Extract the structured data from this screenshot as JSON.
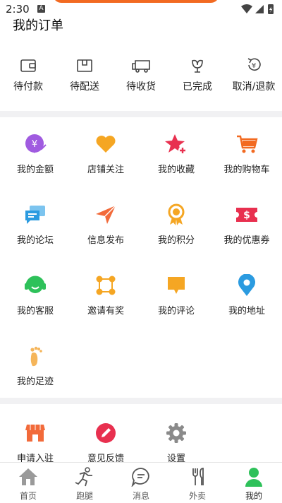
{
  "status_bar": {
    "time": "2:30",
    "sim_label": "A"
  },
  "orders": {
    "title": "我的订单",
    "items": [
      {
        "label": "待付款",
        "icon": "wallet-icon"
      },
      {
        "label": "待配送",
        "icon": "package-icon"
      },
      {
        "label": "待收货",
        "icon": "truck-icon"
      },
      {
        "label": "已完成",
        "icon": "flower-icon"
      },
      {
        "label": "取消/退款",
        "icon": "refund-icon"
      }
    ]
  },
  "services": {
    "items": [
      {
        "label": "我的金额",
        "icon": "money-icon",
        "color": "#a05be0"
      },
      {
        "label": "店铺关注",
        "icon": "heart-icon",
        "color": "#f5a623"
      },
      {
        "label": "我的收藏",
        "icon": "star-plus-icon",
        "color": "#e8304f"
      },
      {
        "label": "我的购物车",
        "icon": "cart-icon",
        "color": "#f26a21"
      },
      {
        "label": "我的论坛",
        "icon": "forum-icon",
        "color": "#2b9be0"
      },
      {
        "label": "信息发布",
        "icon": "paper-plane-icon",
        "color": "#f26a3a"
      },
      {
        "label": "我的积分",
        "icon": "medal-icon",
        "color": "#f5a623"
      },
      {
        "label": "我的优惠券",
        "icon": "coupon-icon",
        "color": "#e8304f"
      },
      {
        "label": "我的客服",
        "icon": "headset-icon",
        "color": "#2ec15a"
      },
      {
        "label": "邀请有奖",
        "icon": "invite-icon",
        "color": "#f5a623"
      },
      {
        "label": "我的评论",
        "icon": "comment-icon",
        "color": "#f5a623"
      },
      {
        "label": "我的地址",
        "icon": "location-icon",
        "color": "#2b9be0"
      },
      {
        "label": "我的足迹",
        "icon": "footprint-icon",
        "color": "#f5b55a"
      }
    ]
  },
  "tools": {
    "items": [
      {
        "label": "申请入驻",
        "icon": "shop-icon",
        "color": "#f26a3a"
      },
      {
        "label": "意见反馈",
        "icon": "feedback-icon",
        "color": "#e8304f"
      },
      {
        "label": "设置",
        "icon": "settings-icon",
        "color": "#8a8a8a"
      }
    ]
  },
  "tabbar": {
    "active_index": 4,
    "tabs": [
      {
        "label": "首页",
        "icon": "home-icon"
      },
      {
        "label": "跑腿",
        "icon": "runner-icon"
      },
      {
        "label": "消息",
        "icon": "message-icon"
      },
      {
        "label": "外卖",
        "icon": "utensils-icon"
      },
      {
        "label": "我的",
        "icon": "user-icon"
      }
    ]
  },
  "colors": {
    "active_tab": "#2ec15a",
    "divider": "#f1f1f3"
  }
}
